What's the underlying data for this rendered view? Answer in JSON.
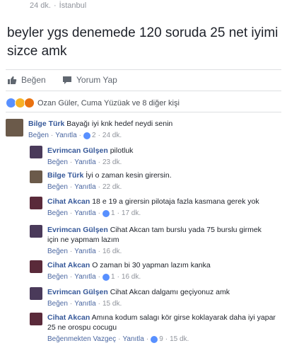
{
  "post": {
    "time": "24 dk.",
    "place": "İstanbul",
    "text": "beyler ygs denemede 120 soruda 25 net iyimi sizce amk"
  },
  "actions": {
    "like": "Beğen",
    "comment": "Yorum Yap"
  },
  "reactions": {
    "summary": "Ozan Güler, Cuma Yüzüak ve 8 diğer kişi"
  },
  "comments": [
    {
      "author": "Bilge Türk",
      "text": "Bayağı iyi knk hedef neydi senin",
      "like": "Beğen",
      "reply": "Yanıtla",
      "count": "2",
      "time": "24 dk.",
      "avatar_color": "#6b5a4a"
    },
    {
      "author": "Evrimcan Gülşen",
      "text": "pilotluk",
      "like": "Beğen",
      "reply": "Yanıtla",
      "count": "",
      "time": "23 dk.",
      "avatar_color": "#4a3a5a"
    },
    {
      "author": "Bilge Türk",
      "text": "İyi o zaman kesin girersin.",
      "like": "Beğen",
      "reply": "Yanıtla",
      "count": "",
      "time": "22 dk.",
      "avatar_color": "#6b5a4a"
    },
    {
      "author": "Cihat Akcan",
      "text": "18 e 19 a girersin pilotaja fazla kasmana gerek yok",
      "like": "Beğen",
      "reply": "Yanıtla",
      "count": "1",
      "time": "17 dk.",
      "avatar_color": "#5a2a3a"
    },
    {
      "author": "Evrimcan Gülşen",
      "text": "Cihat Akcan tam burslu yada 75 burslu girmek için ne yapmam lazım",
      "like": "Beğen",
      "reply": "Yanıtla",
      "count": "",
      "time": "16 dk.",
      "avatar_color": "#4a3a5a"
    },
    {
      "author": "Cihat Akcan",
      "text": "O zaman bi 30 yapman lazım kanka",
      "like": "Beğen",
      "reply": "Yanıtla",
      "count": "1",
      "time": "16 dk.",
      "avatar_color": "#5a2a3a"
    },
    {
      "author": "Evrimcan Gülşen",
      "text": "Cihat Akcan dalgamı geçiyonuz amk",
      "like": "Beğen",
      "reply": "Yanıtla",
      "count": "",
      "time": "15 dk.",
      "avatar_color": "#4a3a5a"
    },
    {
      "author": "Cihat Akcan",
      "text": "Amına kodum salagı kör girse koklayarak daha iyi yapar 25 ne orospu cocugu",
      "like": "Beğenmekten Vazgeç",
      "reply": "Yanıtla",
      "count": "9",
      "time": "15 dk.",
      "avatar_color": "#5a2a3a"
    }
  ]
}
